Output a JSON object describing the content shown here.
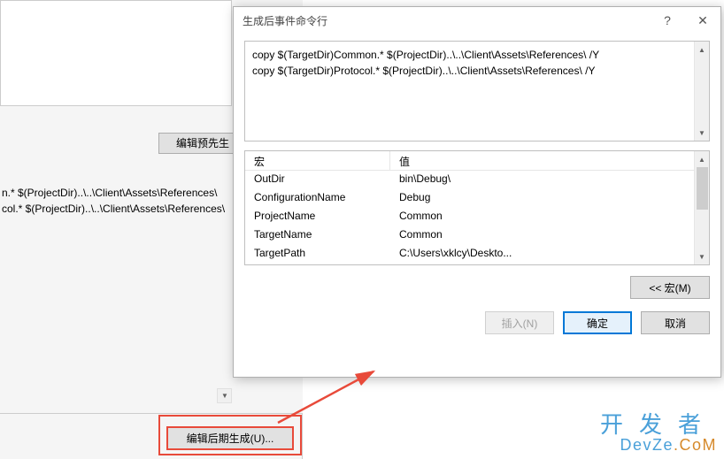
{
  "bg": {
    "pre_btn": "编辑预先生",
    "lines": [
      "n.* $(ProjectDir)..\\..\\Client\\Assets\\References\\",
      "col.* $(ProjectDir)..\\..\\Client\\Assets\\References\\"
    ],
    "post_btn": "编辑后期生成(U)..."
  },
  "dialog": {
    "title": "生成后事件命令行",
    "help": "?",
    "close": "✕",
    "cmd_text": "copy $(TargetDir)Common.* $(ProjectDir)..\\..\\Client\\Assets\\References\\ /Y\ncopy $(TargetDir)Protocol.* $(ProjectDir)..\\..\\Client\\Assets\\References\\ /Y",
    "macro_header": {
      "name": "宏",
      "value": "值"
    },
    "macros": [
      {
        "name": "OutDir",
        "value": "bin\\Debug\\"
      },
      {
        "name": "ConfigurationName",
        "value": "Debug"
      },
      {
        "name": "ProjectName",
        "value": "Common"
      },
      {
        "name": "TargetName",
        "value": "Common"
      },
      {
        "name": "TargetPath",
        "value": "C:\\Users\\xklcy\\Deskto..."
      }
    ],
    "buttons": {
      "macro": "<< 宏(M)",
      "insert": "插入(N)",
      "ok": "确定",
      "cancel": "取消"
    }
  },
  "watermark": {
    "top": "开发者",
    "bottom_pre": "DevZe",
    "bottom_accent": ".CoM"
  }
}
